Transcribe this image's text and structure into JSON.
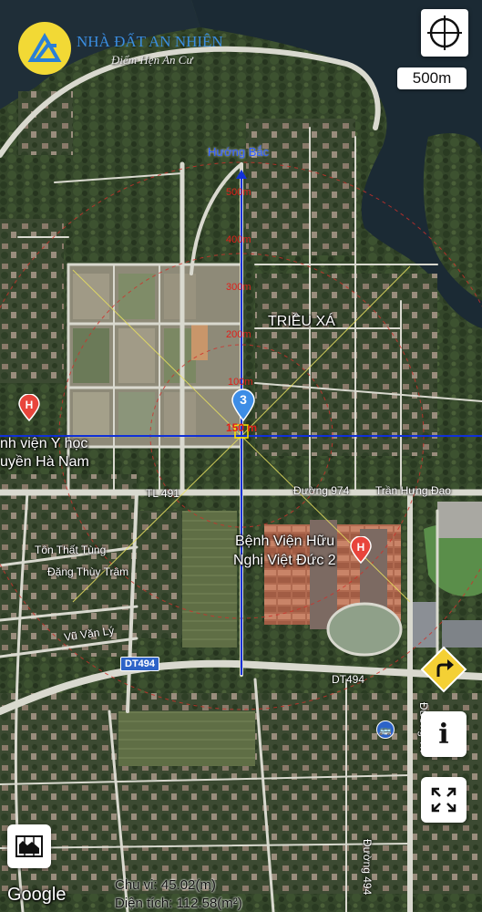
{
  "brand": {
    "name": "NHÀ ĐẤT AN NHIÊN",
    "tagline": "Điểm Hẹn An Cư"
  },
  "scale_label": "500m",
  "north_label": "Hướng Bắc",
  "distance_marks": [
    "500m",
    "400m",
    "300m",
    "200m",
    "100m",
    "150 m"
  ],
  "pin_number": "3",
  "places": {
    "trieu_xa": "TRIỀU XÁ",
    "hospital_left_line1": "nh viện Y học",
    "hospital_left_line2": "uyền Hà Nam",
    "hospital_right_line1": "Bệnh Viện Hữu",
    "hospital_right_line2": "Nghị Việt Đức 2"
  },
  "roads": {
    "tl491": "TL 491",
    "duong974": "Đường 974",
    "tran_hung_dao": "Trần Hưng Đạo",
    "ton_that_tung": "Tôn Thất Tùng",
    "dang_thuy_tram": "Đặng Thùy Trâm",
    "vu_van_ly": "Vũ Văn Lý",
    "dt494_left": "DT494",
    "dt494_right": "DT494",
    "duong494_vertical": "Đường 494",
    "duong_vertical_top": "Đường Th"
  },
  "footer": {
    "perimeter": "Chu vi: 45.02(m)",
    "area": "Diện tích: 112.58(m²)",
    "google": "Google"
  },
  "controls": [
    "locate-icon",
    "directions-icon",
    "info-icon",
    "fullscreen-icon",
    "map-layers-icon"
  ],
  "colors": {
    "water": "#1b2a34",
    "road": "#d9d9cf",
    "blue_line": "#1030d8",
    "red_text": "#e0201a",
    "brand_blue": "#2a7fd6",
    "hospital_red": "#e8453c"
  }
}
